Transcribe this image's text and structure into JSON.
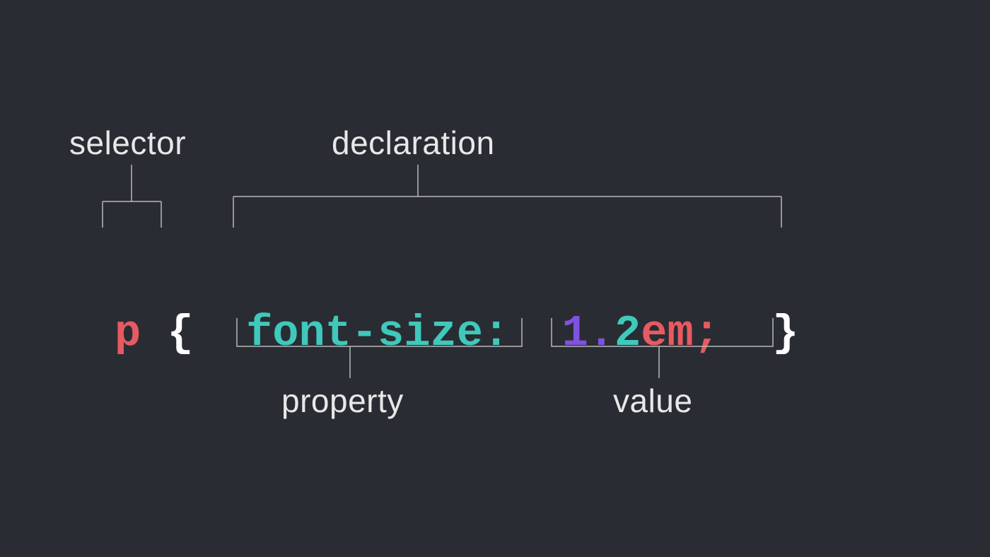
{
  "labels": {
    "selector": "selector",
    "declaration": "declaration",
    "property": "property",
    "value": "value"
  },
  "code": {
    "selector": "p",
    "brace_open": "{",
    "property": "font-size",
    "colon": ":",
    "value_num_a": "1",
    "value_dot": ".",
    "value_num_b": "2",
    "value_unit": "em",
    "semicolon": ";",
    "brace_close": "}"
  }
}
